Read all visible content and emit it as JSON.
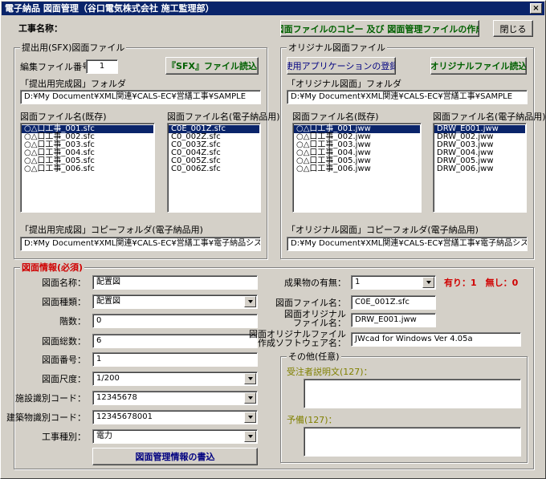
{
  "window": {
    "title": "電子納品 図面管理（谷口電気株式会社 施工監理部）",
    "close_glyph": "×"
  },
  "top": {
    "project_label": "工事名称：",
    "copy_button": "図面ファイルのコピー 及び 図面管理ファイルの作成",
    "close_button": "閉じる"
  },
  "sfx": {
    "group_title": "提出用(SFX)図面ファイル",
    "edit_no_label": "編集ファイル番号：",
    "edit_no_value": "1",
    "read_button": "『SFX』ファイル読込",
    "folder_label": "「提出用完成図」フォルダ",
    "folder_value": "D:¥My Document¥XML関連¥CALS-EC¥営繕工事¥SAMPLE",
    "list1_label": "図面ファイル名(既存)",
    "list1": [
      "○△口工事_001.sfc",
      "○△口工事_002.sfc",
      "○△口工事_003.sfc",
      "○△口工事_004.sfc",
      "○△口工事_005.sfc",
      "○△口工事_006.sfc"
    ],
    "list2_label": "図面ファイル名(電子納品用)",
    "list2": [
      "C0E_001Z.sfc",
      "C0_002Z.sfc",
      "C0_003Z.sfc",
      "C0_004Z.sfc",
      "C0_005Z.sfc",
      "C0_006Z.sfc"
    ],
    "copy_folder_label": "「提出用完成図」コピーフォルダ(電子納品用)",
    "copy_folder_value": "D:¥My Document¥XML関連¥CALS-EC¥営繕工事¥電子納品システム"
  },
  "orig": {
    "group_title": "オリジナル図面ファイル",
    "app_button": "使用アプリケーションの登録",
    "read_button": "オリジナルファイル読込",
    "folder_label": "「オリジナル図面」フォルダ",
    "folder_value": "D:¥My Document¥XML関連¥CALS-EC¥営繕工事¥SAMPLE",
    "list1_label": "図面ファイル名(既存)",
    "list1": [
      "○△口工事_001.jww",
      "○△口工事_002.jww",
      "○△口工事_003.jww",
      "○△口工事_004.jww",
      "○△口工事_005.jww",
      "○△口工事_006.jww"
    ],
    "list2_label": "図面ファイル名(電子納品用)",
    "list2": [
      "DRW_E001.jww",
      "DRW_002.jww",
      "DRW_003.jww",
      "DRW_004.jww",
      "DRW_005.jww",
      "DRW_006.jww"
    ],
    "copy_folder_label": "「オリジナル図面」コピーフォルダ(電子納品用)",
    "copy_folder_value": "D:¥My Document¥XML関連¥CALS-EC¥営繕工事¥電子納品システム"
  },
  "info": {
    "group_title": "図面情報(必須)",
    "name_label": "図面名称：",
    "name_value": "配置図",
    "type_label": "図面種類：",
    "type_value": "配置図",
    "floor_label": "階数：",
    "floor_value": "0",
    "total_label": "図面総数：",
    "total_value": "6",
    "number_label": "図面番号：",
    "number_value": "1",
    "scale_label": "図面尺度：",
    "scale_value": "1/200",
    "facility_label": "施設識別コード：",
    "facility_value": "12345678",
    "building_label": "建築物識別コード：",
    "building_value": "12345678001",
    "work_label": "工事種別：",
    "work_value": "電力",
    "write_button": "図面管理情報の書込",
    "product_label": "成果物の有無：",
    "product_value": "1",
    "product_note": "有り：1　無し：0",
    "file_label": "図面ファイル名：",
    "file_value": "C0E_001Z.sfc",
    "orig_file_label1": "図面オリジナル",
    "orig_file_label2": "ファイル名：",
    "orig_file_value": "DRW_E001.jww",
    "soft_label1": "図面オリジナルファイル",
    "soft_label2": "作成ソフトウェア名：",
    "soft_value": "JWcad for Windows Ver 4.05a",
    "other_title": "その他(任意)",
    "contractor_label": "受注者説明文(127)：",
    "reserve_label": "予備(127)："
  }
}
